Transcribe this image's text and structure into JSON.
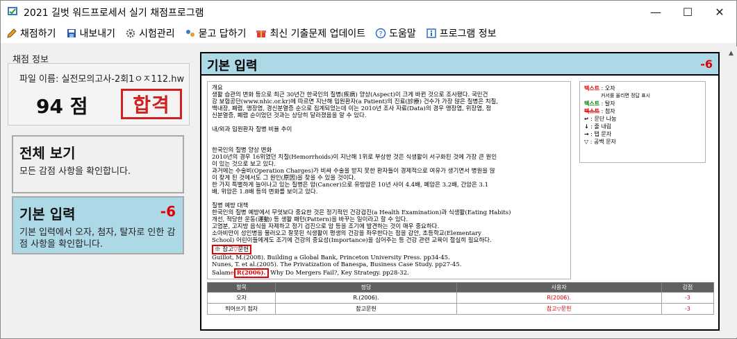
{
  "window": {
    "title": "2021 길벗 워드프로세서 실기 채점프로그램",
    "minimize": "—",
    "maximize": "☐",
    "close": "✕"
  },
  "menu": [
    {
      "label": "채점하기",
      "icon": "pencil-icon"
    },
    {
      "label": "내보내기",
      "icon": "save-icon"
    },
    {
      "label": "시험관리",
      "icon": "gear-icon"
    },
    {
      "label": "묻고 답하기",
      "icon": "chat-icon"
    },
    {
      "label": "최신 기출문제 업데이트",
      "icon": "gift-icon"
    },
    {
      "label": "도움말",
      "icon": "help-icon"
    },
    {
      "label": "프로그램 정보",
      "icon": "info-icon"
    }
  ],
  "score": {
    "section_label": "채점 정보",
    "file_name": "파일 이름: 실전모의고사-2회1ㅇㅈ112.hwp",
    "value": "94 점",
    "result": "합격"
  },
  "cards": {
    "all": {
      "title": "전체 보기",
      "desc": "모든 감점 사항을 확인합니다."
    },
    "basic": {
      "title": "기본 입력",
      "penalty": "-6",
      "desc": "기본 입력에서 오자, 첨자, 탈자로 인한 감점 사항을 확인합니다."
    }
  },
  "doc": {
    "title": "기본 입력",
    "penalty": "-6",
    "lines": [
      "개요",
      "생활 습관의 변화 등으로 최근 30년간 한국인의 질병(疾病) 양상(Aspect)이 크게 바뀐 것으로 조사됐다. 국민건",
      "강 보험공단(www.nhic.or.kr)에 따르면 지난해 입원환자(a Patient)의 진료(診療) 건수가 가장 많은 질병은 치질,",
      "백내장, 폐렴, 맹장염, 경신분열증 순으로 집계되었는데 이는 2010년 조사 자료(Data)의 경우 맹장염, 위장염, 정",
      "신분열증, 폐렴 순이었던 것과는 상당히 달라졌음을 알 수 있다.",
      "",
      "내/외과 입원환자 질병 비율 추이",
      "",
      "",
      "한국인의 질병 양상 변화",
      "2010년의 경우 16위였던 치질(Hemorrhoids)이 지난해 1위로 부상한 것은 식생활이 서구화된 것에 가장 큰 원인",
      "이 있는 것으로 보고 있다.",
      "과거에는 수술비(Operation Charges)가 비싸 수술을 받지 못한 환자들이 경제적으로 여유가 생기면서 병원을 많",
      "이 찾게 된 것에서도 그 원인(原因)을 찾을 수 있을 것이다.",
      "한 가지 특별하게 늘어나고 있는 질병은 암(Cancer)으로 유방암은 10년 사이 4.4배, 폐암은 3.2배, 간암은 3.1",
      "배, 위암은 1.8배 등의 변화를 보이고 있다.",
      "",
      "질병 예방 대책",
      "한국인의 질병 예방에서 무엇보다 중요한 것은 정기적인 건강검진(a Health Examination)과 식생활(Eating Habits)",
      "개선, 적당한 운동(運動) 등 생활 패턴(Pattern)을 바꾸는 일이라고 할 수 있다.",
      "고염분, 고지방 음식을 자제하고 정기 검진으로 암 등을 조기에 발견하는 것이 매우 중요하다.",
      "소아비만이 성인병을 불러오고 잘못된 식생활이 평생의 건강을 좌우한다는 점을 감안, 초등학교(Elementary",
      "School) 어린이들에게도 조기에 건강의 중요성(Importance)을 심어주는 등 건강 관련 교육이 절실히 필요하다."
    ],
    "ref_prefix": "※ 참고",
    "ref_mark": "▽",
    "ref_suffix": "문헌",
    "ref_lines": [
      "Guillot, M.(2008). Building a Global Bank, Princeton University Press. pp34-45.",
      "Nunes, T. et al.(2005). The Privatization of Banespa, Business Case Study. pp27-45."
    ],
    "last_pre": "Salam",
    "last_red": "e",
    "last_box": "R(2006).",
    "last_post": " Why Do Mergers Fail?, Key Strategy. pp28-32."
  },
  "legend": {
    "items": [
      {
        "key": "텍스트",
        "text": " : 오자"
      },
      {
        "key": "",
        "text": "커서를 올리면 정답 표시"
      },
      {
        "key": "텍스트",
        "text": " : 탈자"
      },
      {
        "key": "텍스트",
        "text": " : 첨자"
      },
      {
        "key": "↵",
        "text": " : 문단 나눔"
      },
      {
        "key": "↓",
        "text": " : 줄 내림"
      },
      {
        "key": "→",
        "text": " : 탭 문자"
      },
      {
        "key": "▽",
        "text": " : 공백 문자"
      }
    ],
    "colors": {
      "error": "#e00000",
      "missing": "#008000",
      "extra": "#e00000"
    }
  },
  "table": {
    "headers": [
      "항목",
      "정답",
      "사용자",
      "감점"
    ],
    "rows": [
      [
        "오자",
        "R.(2006).",
        "R(2006).",
        "-3"
      ],
      [
        "띄어쓰기 첨자",
        "참고문헌",
        "참고▽문헌",
        "-3"
      ]
    ]
  }
}
